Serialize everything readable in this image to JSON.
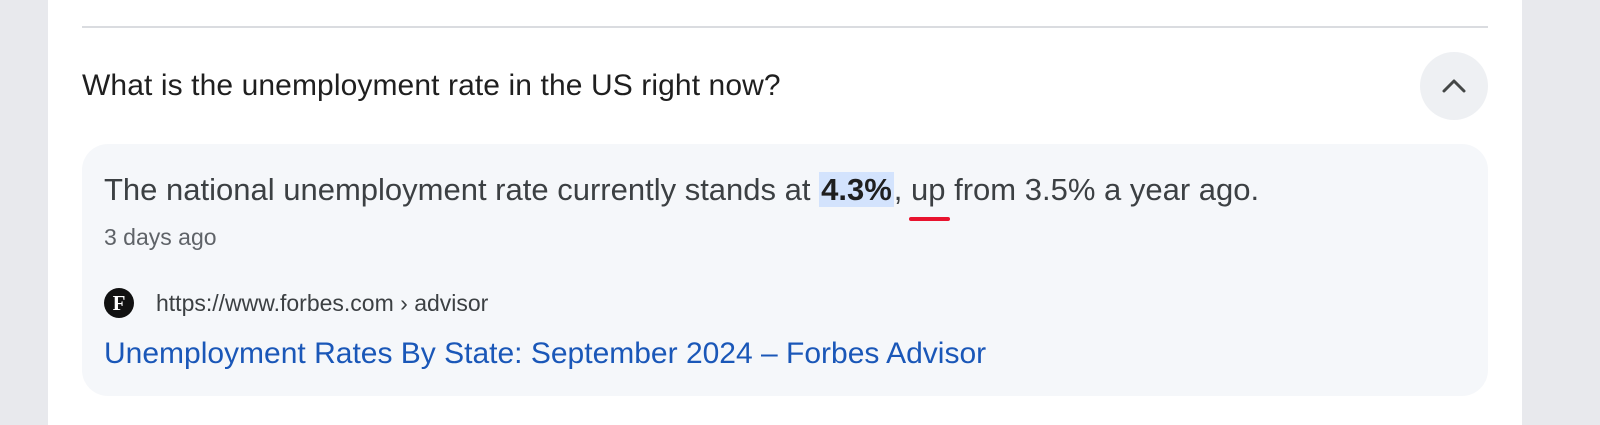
{
  "faq": {
    "question": "What is the unemployment rate in the US right now?",
    "collapse_icon": "chevron-up-icon",
    "answer": {
      "text_before": "The national unemployment rate currently stands at ",
      "highlight": "4.3%",
      "text_comma": ", ",
      "underlined_word": "up",
      "text_after": " from 3.5% a year ago.",
      "timestamp": "3 days ago"
    },
    "source": {
      "favicon_letter": "F",
      "url": "https://www.forbes.com › advisor",
      "link_title": "Unemployment Rates By State: September 2024 – Forbes Advisor"
    }
  },
  "colors": {
    "highlight_bg": "#d3e3fd",
    "underline": "#e8132e",
    "link": "#1a57b8",
    "card_bg": "#f5f7fa"
  }
}
